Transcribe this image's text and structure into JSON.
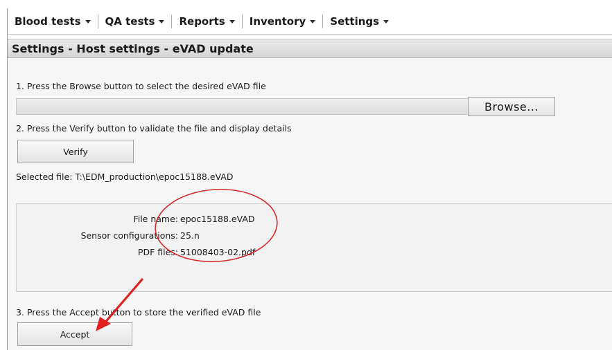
{
  "menu": {
    "items": [
      {
        "label": "Blood tests"
      },
      {
        "label": "QA tests"
      },
      {
        "label": "Reports"
      },
      {
        "label": "Inventory"
      },
      {
        "label": "Settings"
      }
    ]
  },
  "page": {
    "title": "Settings - Host settings - eVAD update"
  },
  "steps": {
    "step1": "1. Press the Browse button to select the desired eVAD file",
    "step2": "2. Press the Verify button to validate the file and display details",
    "step3": "3. Press the Accept button to store the verified eVAD file"
  },
  "file_input": {
    "value": "",
    "browse_label": "Browse..."
  },
  "verify_label": "Verify",
  "selected_file": "Selected file: T:\\EDM_production\\epoc15188.eVAD",
  "details": {
    "file_name_label": "File name:",
    "file_name_value": "epoc15188.eVAD",
    "sensor_label": "Sensor configurations:",
    "sensor_value": "25.n",
    "pdf_label": "PDF files:",
    "pdf_value": "51008403-02.pdf"
  },
  "accept_label": "Accept",
  "annotation_colors": {
    "ellipse": "#d42a2a",
    "arrow": "#e02020"
  }
}
